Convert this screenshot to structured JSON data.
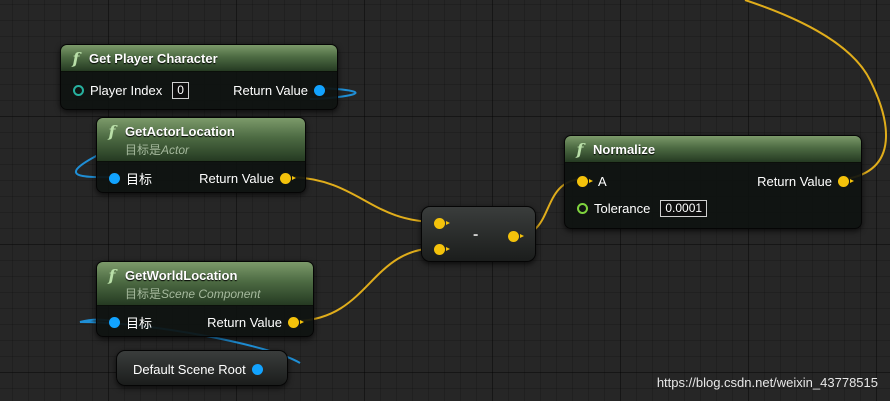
{
  "nodes": {
    "get_player_character": {
      "title": "Get Player Character",
      "player_index_label": "Player Index",
      "player_index_value": "0",
      "return_label": "Return Value"
    },
    "get_actor_location": {
      "title": "GetActorLocation",
      "subtitle_prefix": "目标是",
      "subtitle_class": "Actor",
      "target_label": "目标",
      "return_label": "Return Value"
    },
    "get_world_location": {
      "title": "GetWorldLocation",
      "subtitle_prefix": "目标是",
      "subtitle_class": "Scene Component",
      "target_label": "目标",
      "return_label": "Return Value"
    },
    "default_scene_root": {
      "label": "Default Scene Root"
    },
    "subtract": {
      "symbol": "-"
    },
    "normalize": {
      "title": "Normalize",
      "a_label": "A",
      "tolerance_label": "Tolerance",
      "tolerance_value": "0.0001",
      "return_label": "Return Value"
    }
  },
  "watermark": "https://blog.csdn.net/weixin_43778515",
  "colors": {
    "vector_wire": "#e0ad1b",
    "object_wire": "#1f8fd6",
    "vector_pin": "#f4c20b",
    "object_pin": "#12a3ff",
    "float_pin": "#7fd33e",
    "exec_pin": "#27b19f"
  }
}
